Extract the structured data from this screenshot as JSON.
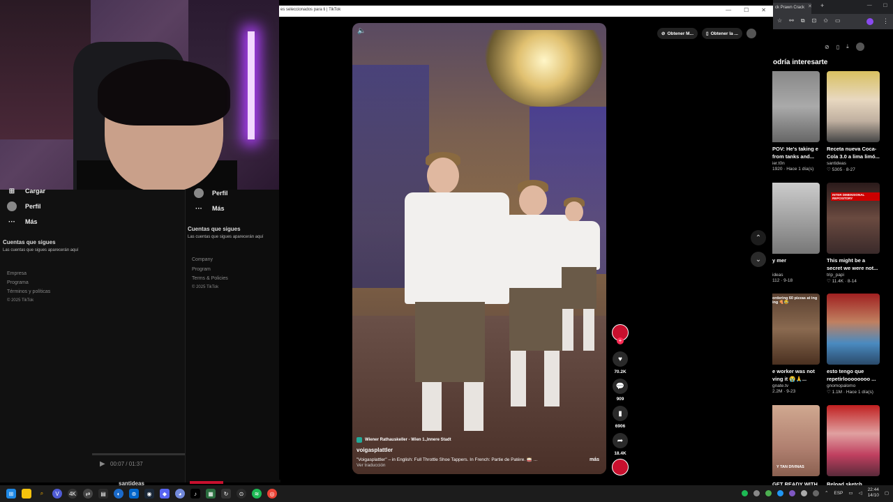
{
  "main_window": {
    "title": "es seleccionados para ti | TikTok",
    "controls": [
      "—",
      "☐",
      "✕"
    ]
  },
  "left_sidebar": {
    "nav": [
      {
        "label": "Cargar",
        "icon": "upload-icon"
      },
      {
        "label": "Perfil",
        "icon": "avatar"
      },
      {
        "label": "Más",
        "icon": "more-icon"
      }
    ],
    "following_title": "Cuentas que sigues",
    "following_text": "Las cuentas que sigues aparecerán aquí",
    "footer_links": [
      "Empresa",
      "Programa",
      "Términos y políticas"
    ],
    "copyright": "© 2025 TikTok"
  },
  "middle_sidebar": {
    "nav": [
      {
        "label": "Perfil",
        "icon": "avatar"
      },
      {
        "label": "Más",
        "icon": "more-icon"
      }
    ],
    "following_title": "Cuentas que sigues",
    "following_text": "Las cuentas que sigues aparecerán aquí",
    "footer_links": [
      "Company",
      "Program",
      "Terms & Policies"
    ],
    "copyright": "© 2025 TikTok"
  },
  "player": {
    "time": "00:07 / 01:37",
    "username": "santideas"
  },
  "top_actions": {
    "get_app_1": "Obtener M...",
    "get_app_2": "Obtener la ..."
  },
  "video": {
    "location": "Wiener Rathauskeller - Wien 1.,Innere Stadt",
    "username": "voigasplattler",
    "description": "\"Voigasplattler\" – in English: Full Throttle Shoe Tappers. In French: Partie de Patère. 🥁 ...",
    "more": "más",
    "translate": "Ver traducción",
    "likes": "70.2K",
    "comments": "909",
    "saves": "6906",
    "shares": "18.4K"
  },
  "right_browser": {
    "tab_title": "ck Prawn Crack",
    "heading": "odría interesarte",
    "cards_left": [
      {
        "title": "POV: He's taking e from tanks and...",
        "author": "ier.t0n",
        "stats": "1920 · Hace 1 día(s)"
      },
      {
        "title": "y mer",
        "author": "ideas",
        "stats": "112 · 9-18"
      },
      {
        "title": "e worker was not ving it 😭🙏...",
        "author": "gnate.tv",
        "stats": "2.2M · 9-23"
      },
      {
        "title": "GET READY WITH",
        "author": "",
        "stats": ""
      }
    ],
    "cards_right": [
      {
        "title": "Receta nueva Coca-Cola 3.0 a lima limó...",
        "author": "santideas",
        "stats": "♡ 5305 · 8-27"
      },
      {
        "title": "This might be a secret we were not...",
        "author": "trip_papi",
        "stats": "♡ 11.4K · 8-14"
      },
      {
        "title": "esto tengo que repetirloooooooo ...",
        "author": "gnomopalomo",
        "stats": "♡ 1.1M · Hace 1 día(s)"
      },
      {
        "title": "Reload sketch",
        "author": "",
        "stats": ""
      }
    ],
    "thumb_captions": {
      "interdimensional": "INTER DIMENSIONAL REPOSITORY",
      "pizzas": "ordering 60 pizzas at ing ing 🍕😂",
      "divinas": "Y TAN DIVINAS"
    }
  },
  "taskbar": {
    "lang": "ESP",
    "time": "22:44",
    "date": "14/10"
  },
  "colors": {
    "tiktok_red": "#fe2c55",
    "bg": "#000000"
  }
}
